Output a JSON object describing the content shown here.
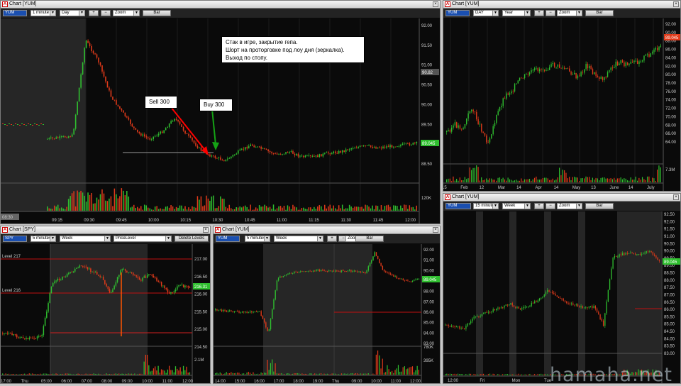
{
  "windows": {
    "main": {
      "title": "Chart [YUM]",
      "symbol": "YUM",
      "interval": "1 minute",
      "period": "Day",
      "zoom": "Zoom",
      "style": "Bar",
      "price_labels": [
        "92.00",
        "91.50",
        "91.00",
        "90.50",
        "90.00",
        "89.50",
        "89.00",
        "88.50"
      ],
      "current_price": "89.045",
      "marker_price": "90.82",
      "volume_label": "120K",
      "time_labels": [
        "09:15",
        "09:30",
        "09:45",
        "10:00",
        "10:15",
        "10:30",
        "10:45",
        "11:00",
        "11:15",
        "11:30",
        "11:45",
        "12:00"
      ],
      "time_first": "08:30",
      "annotation": [
        "Стак в игре, закрытие гепа.",
        "Шорт на проторговке под лоу дня (зеркалка).",
        "Выход по стопу."
      ],
      "sell_label": "Sell 300",
      "buy_label": "Buy 300"
    },
    "daily": {
      "title": "Chart [YUM]",
      "symbol": "YUM",
      "interval": "DAY",
      "period": "Year",
      "zoom": "Zoom",
      "style": "Bar",
      "price_labels": [
        "92.00",
        "90.00",
        "88.00",
        "86.00",
        "84.00",
        "82.00",
        "80.00",
        "78.00",
        "76.00",
        "74.00",
        "72.00",
        "70.00",
        "68.00",
        "66.00",
        "64.00"
      ],
      "current_price": "89.045",
      "volume_label": "7.3M",
      "time_labels": [
        "15",
        "Feb",
        "12",
        "Mar",
        "14",
        "Apr",
        "14",
        "May",
        "13",
        "June",
        "14",
        "July"
      ]
    },
    "spy": {
      "title": "Chart [SPY]",
      "symbol": "SPY",
      "interval": "5 minutes",
      "period": "Week",
      "tool": "PriceLevel",
      "delete": "Delete Levels",
      "price_labels": [
        "217.00",
        "216.50",
        "216.00",
        "215.50",
        "215.00",
        "214.50"
      ],
      "current_price": "216.31",
      "level_labels": [
        "Level 217",
        "Level 216"
      ],
      "volume_label": "2.1M",
      "time_labels": [
        "17:00",
        "Thu",
        "05:00",
        "06:00",
        "07:00",
        "08:00",
        "09:00",
        "10:00",
        "11:00",
        "12:00"
      ]
    },
    "yum5": {
      "title": "Chart [YUM]",
      "symbol": "YUM",
      "interval": "5 minutes",
      "period": "Week",
      "zoom": "Zoom",
      "style": "Bar",
      "price_labels": [
        "92.00",
        "91.00",
        "90.00",
        "89.00",
        "88.00",
        "87.00",
        "86.00",
        "85.00",
        "84.00",
        "83.00"
      ],
      "current_price": "89.045",
      "volume_labels": [
        "780K",
        "395K"
      ],
      "time_labels": [
        "14:00",
        "15:00",
        "16:00",
        "17:00",
        "18:00",
        "19:00",
        "Thu",
        "09:00",
        "10:00",
        "11:00",
        "12:00"
      ]
    },
    "yum15": {
      "title": "Chart [YUM]",
      "symbol": "YUM",
      "interval": "15 minutes",
      "period": "Week",
      "zoom": "Zoom",
      "style": "Bar",
      "price_labels": [
        "92.50",
        "92.00",
        "91.50",
        "91.00",
        "90.50",
        "90.00",
        "89.50",
        "89.00",
        "88.50",
        "88.00",
        "87.50",
        "87.00",
        "86.50",
        "86.00",
        "85.50",
        "85.00",
        "84.50",
        "84.00",
        "83.50",
        "83.00"
      ],
      "current_price": "89.045",
      "time_labels": [
        "12:00",
        "Fri",
        "Mon",
        "Tue"
      ]
    }
  },
  "watermark": "hamaha.net",
  "colors": {
    "up": "#2fbf2f",
    "down": "#e03a1a",
    "session": "#262626",
    "bg": "#0a0a0a",
    "level": "#c01010"
  }
}
